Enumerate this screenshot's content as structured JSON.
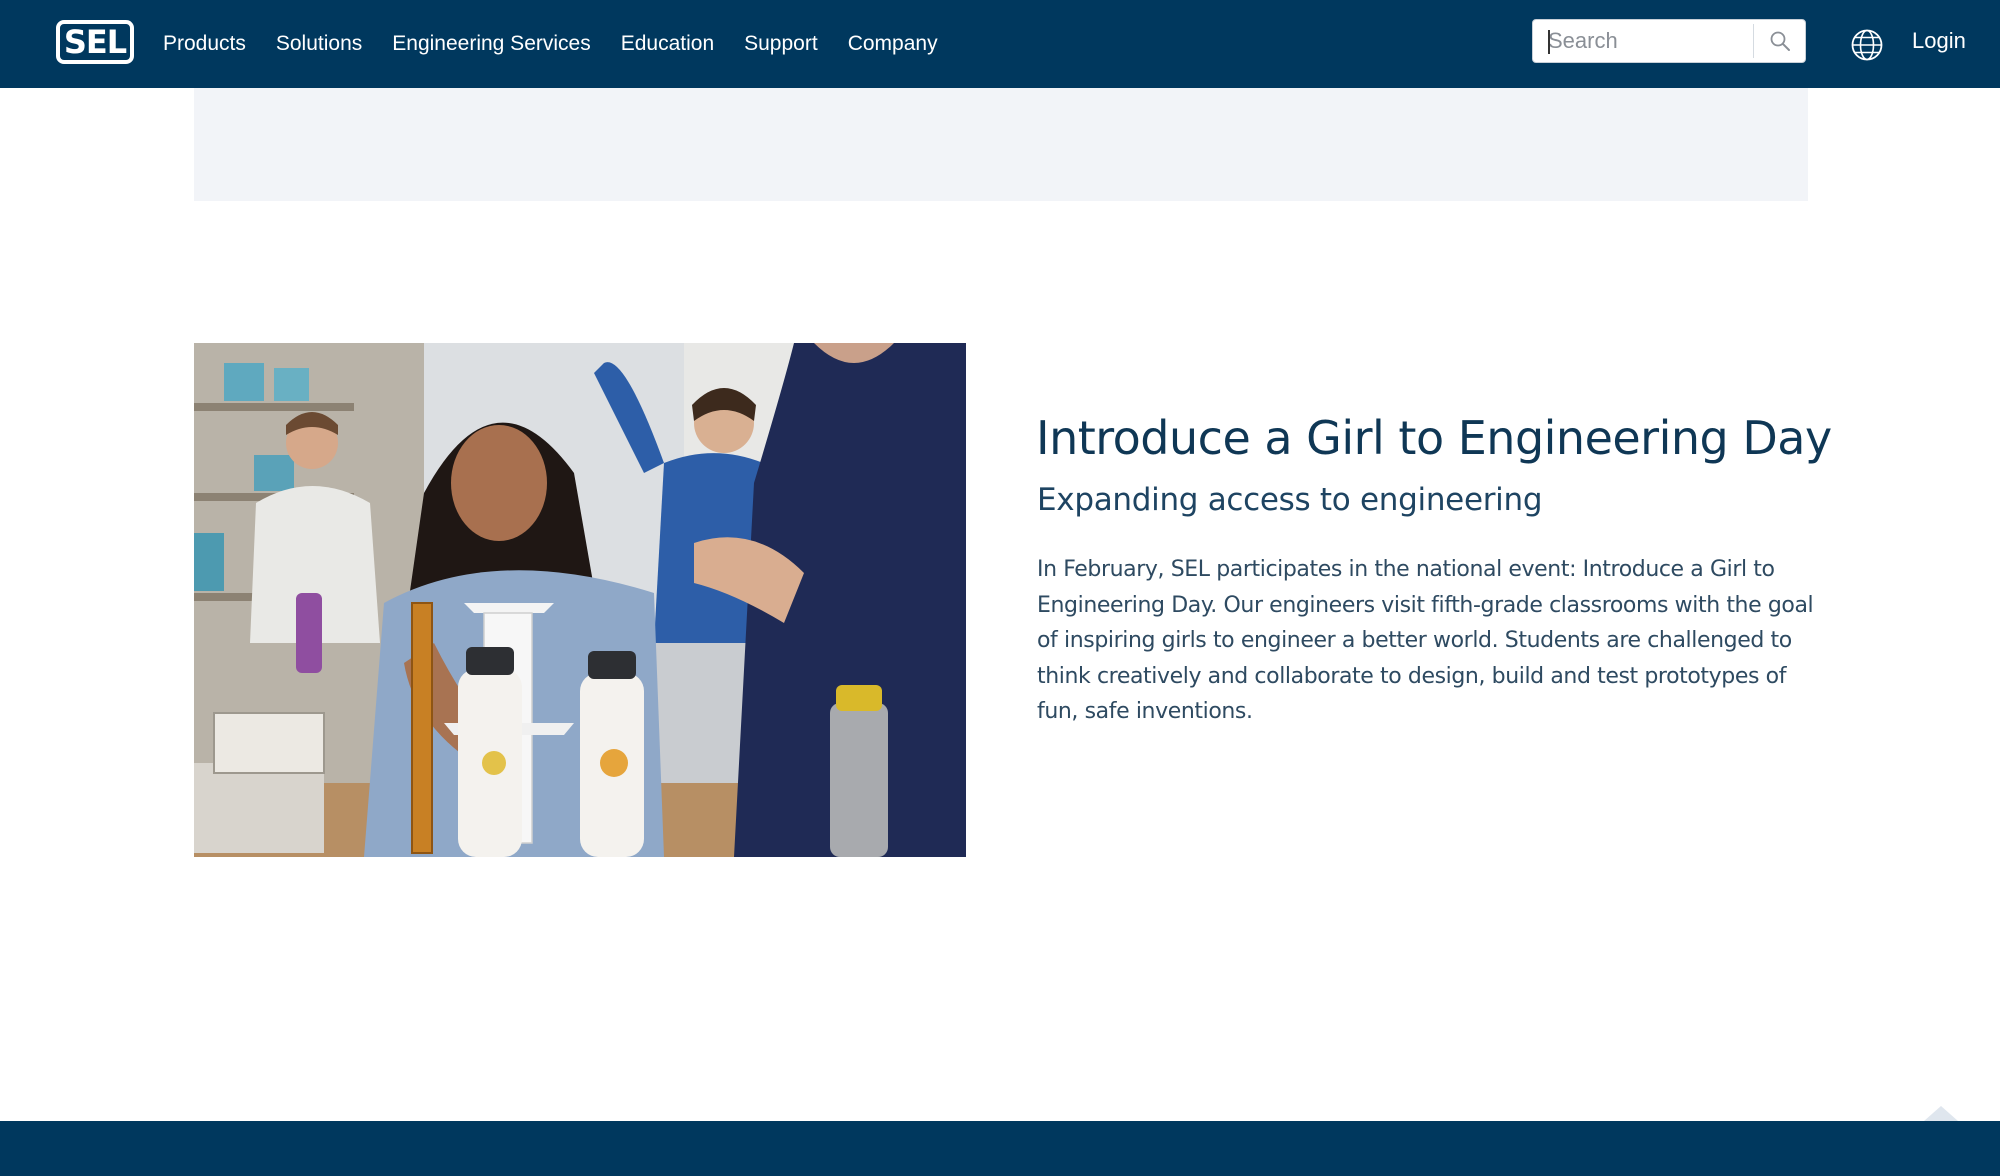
{
  "header": {
    "logo_text": "SEL",
    "nav": [
      {
        "label": "Products"
      },
      {
        "label": "Solutions"
      },
      {
        "label": "Engineering Services"
      },
      {
        "label": "Education"
      },
      {
        "label": "Support"
      },
      {
        "label": "Company"
      }
    ],
    "search": {
      "placeholder": "Search",
      "icon": "search-icon"
    },
    "language_icon": "globe-icon",
    "login_label": "Login"
  },
  "feature": {
    "image_alt": "Classroom photo: an engineer helps students build a paper tower prototype",
    "title": "Introduce a Girl to Engineering Day",
    "subtitle": "Expanding access to engineering",
    "body": "In February, SEL participates in the national event: Introduce a Girl to Engineering Day. Our engineers visit fifth-grade classrooms with the goal of inspiring girls to engineer a better world. Students are challenged to think creatively and collaborate to design, build and test prototypes of fun, safe inventions."
  },
  "colors": {
    "brand_navy": "#00385e",
    "heading_text": "#0f3755",
    "band_gray": "#f2f4f8"
  }
}
